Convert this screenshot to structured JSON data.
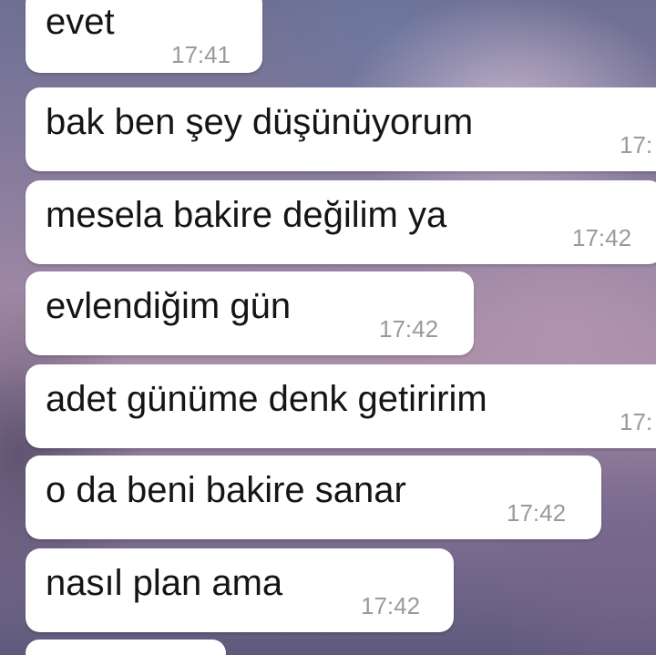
{
  "chat": {
    "messages": [
      {
        "text": "evet",
        "time": "17:41"
      },
      {
        "text": "bak ben şey düşünüyorum",
        "time": "17:"
      },
      {
        "text": "mesela bakire değilim ya",
        "time": "17:42"
      },
      {
        "text": "evlendiğim gün",
        "time": "17:42"
      },
      {
        "text": "adet günüme denk getiririm",
        "time": "17:"
      },
      {
        "text": "o da beni bakire sanar",
        "time": "17:42"
      },
      {
        "text": "nasıl plan ama",
        "time": "17:42"
      }
    ]
  }
}
